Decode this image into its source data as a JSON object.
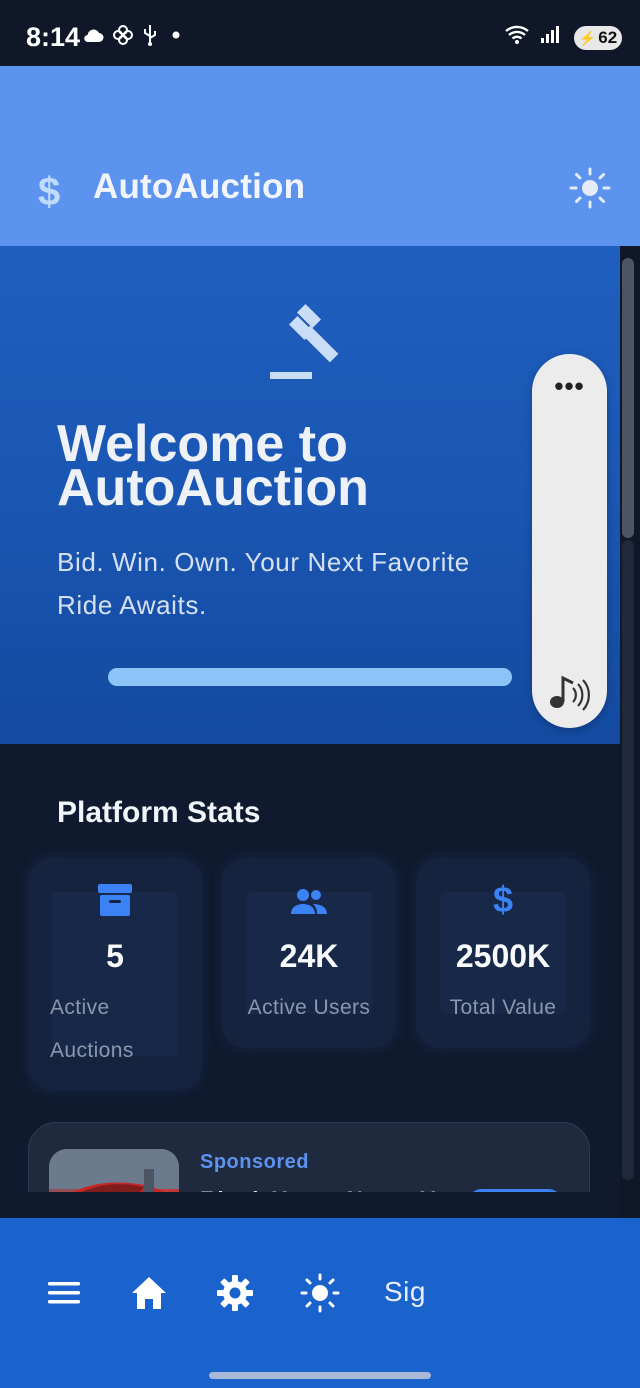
{
  "status_bar": {
    "time": "8:14",
    "battery": "62",
    "left_icons": [
      "cloud-icon",
      "pinwheel-icon",
      "usb-icon",
      "dot-icon"
    ],
    "right_icons": [
      "wifi-icon",
      "signal-icon",
      "battery-icon"
    ]
  },
  "app_bar": {
    "logo_icon": "dollar-icon",
    "logo_glyph": "$",
    "title": "AutoAuction",
    "theme_icon": "sun-icon"
  },
  "hero": {
    "icon": "gavel-icon",
    "title": "Welcome to AutoAuction",
    "subtitle": "Bid. Win. Own. Your Next Favorite Ride Awaits."
  },
  "floating_pill": {
    "more_label": "•••",
    "sound_icon": "music-note-sound-icon"
  },
  "stats": {
    "title": "Platform Stats",
    "items": [
      {
        "icon": "archive-box-icon",
        "value": "5",
        "label": "Active Auctions"
      },
      {
        "icon": "users-icon",
        "value": "24K",
        "label": "Active Users"
      },
      {
        "icon": "dollar-icon",
        "value": "2500K",
        "label": "Total Value"
      }
    ]
  },
  "sponsored": {
    "tag": "Sponsored",
    "headline": "Find Your Next V..."
  },
  "bottom_nav": {
    "items": [
      {
        "icon": "menu-icon"
      },
      {
        "icon": "home-icon"
      },
      {
        "icon": "gear-icon"
      },
      {
        "icon": "sun-icon"
      }
    ],
    "signin_label": "Sig"
  },
  "colors": {
    "app_bar": "#5b93ef",
    "hero": "#1a56b3",
    "background": "#101a2e",
    "bottom_nav": "#1b63cc",
    "accent": "#3b82f6"
  }
}
